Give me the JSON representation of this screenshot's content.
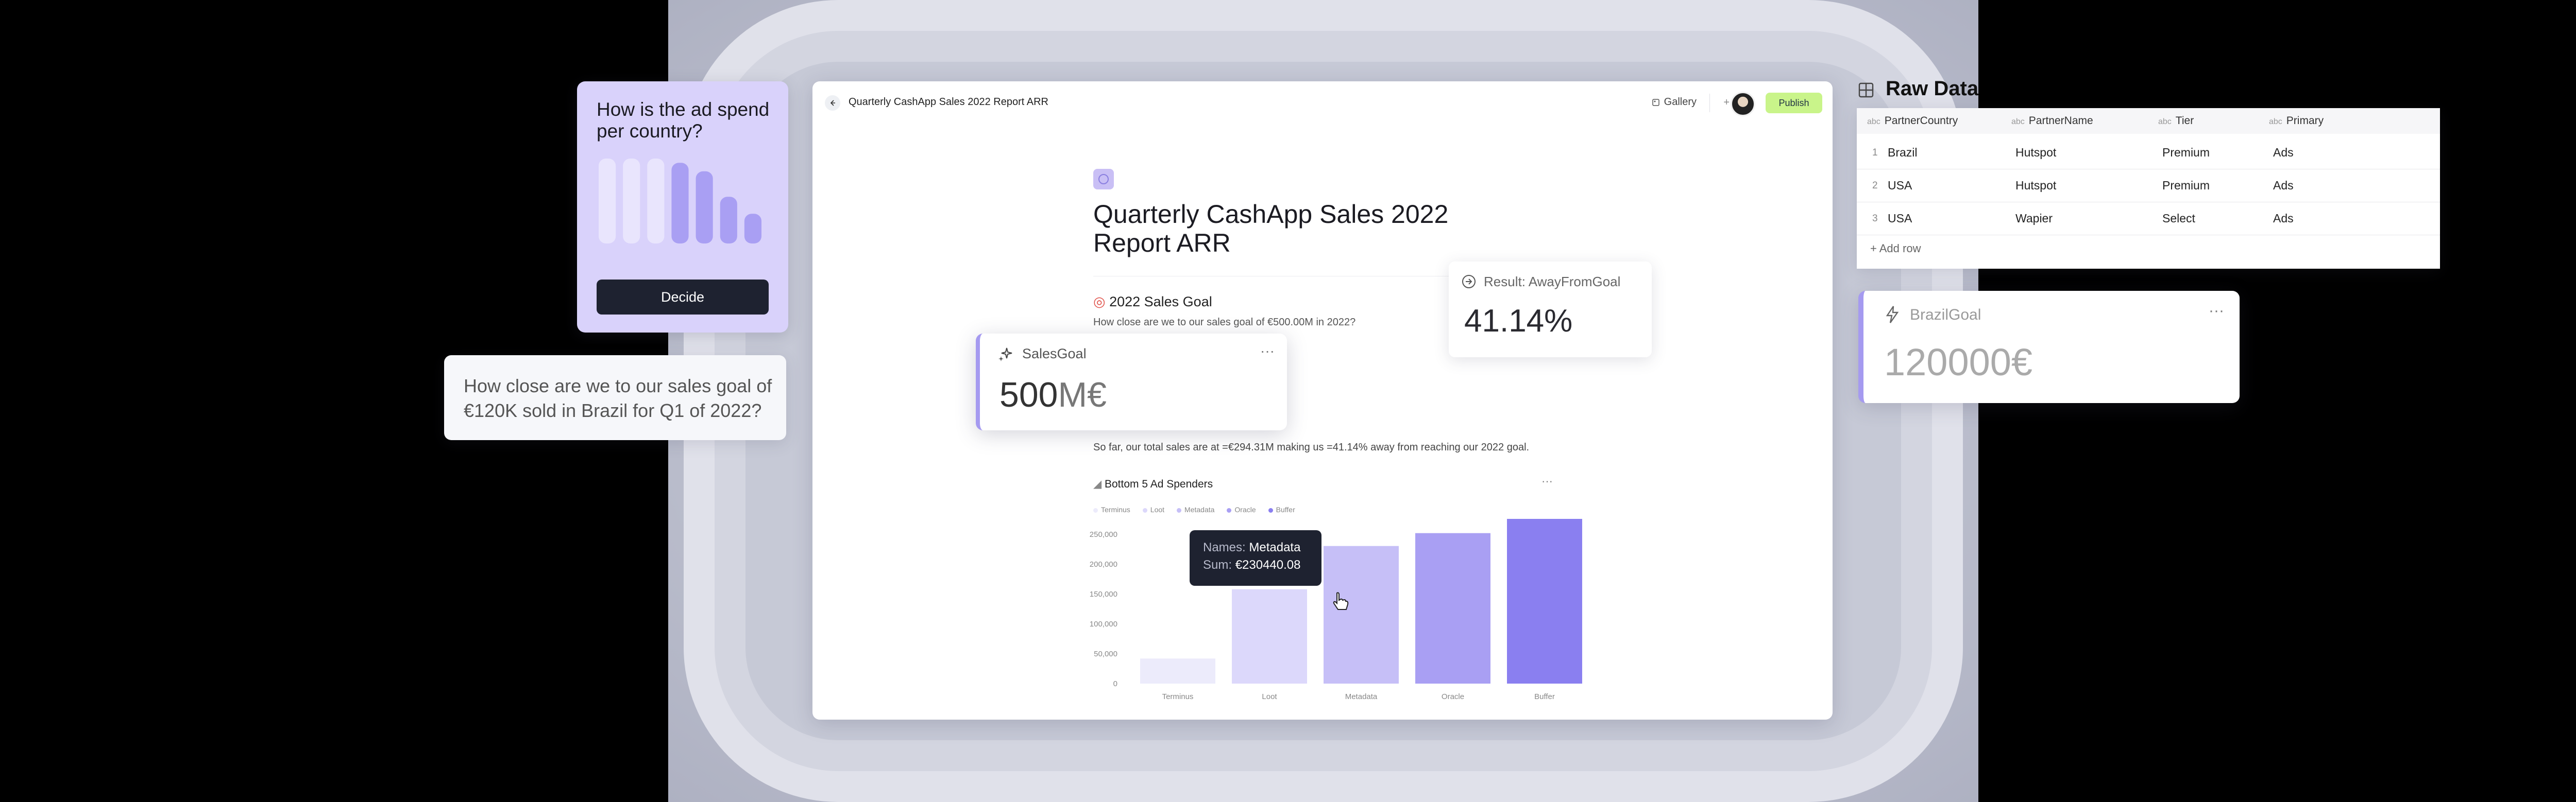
{
  "window": {
    "title": "Quarterly CashApp Sales 2022 Report ARR",
    "gallery_label": "Gallery",
    "publish_label": "Publish"
  },
  "document": {
    "title": "Quarterly CashApp Sales 2022 Report ARR",
    "section_title": "2022 Sales Goal",
    "section_sub": "How close are we to our sales goal of €500.00M in 2022?",
    "summary": "So far, our total sales are at =€294.31M making us =41.14% away from reaching our 2022 goal.",
    "chart_title": "Bottom 5 Ad Spenders"
  },
  "chart_data": {
    "type": "bar",
    "categories": [
      "Terminus",
      "Loot",
      "Metadata",
      "Oracle",
      "Buffer"
    ],
    "values": [
      42000,
      158000,
      230440.08,
      252000,
      290000
    ],
    "ylim": [
      0,
      250000
    ],
    "yticks": [
      "250,000",
      "200,000",
      "150,000",
      "100,000",
      "50,000",
      "0"
    ],
    "ytick_values": [
      250000,
      200000,
      150000,
      100000,
      50000,
      0
    ],
    "legend": [
      "Terminus",
      "Loot",
      "Metadata",
      "Oracle",
      "Buffer"
    ],
    "colors": [
      "#ecebfb",
      "#dcd8fb",
      "#c6bff7",
      "#a99ff3",
      "#8a7ff0"
    ]
  },
  "tooltip": {
    "names_key": "Names:",
    "names_val": "Metadata",
    "sum_key": "Sum:",
    "sum_val": "€230440.08"
  },
  "card_ad": {
    "question": "How is the ad spend per country?",
    "button": "Decide",
    "mini_bars": [
      1,
      1,
      1,
      0.95,
      0.85,
      0.55,
      0.35
    ]
  },
  "card_q2": {
    "text": "How close are we to our sales goal of €120K sold in Brazil for Q1 of 2022?"
  },
  "sales_goal": {
    "label": "SalesGoal",
    "value": "500",
    "unit": "M€"
  },
  "result": {
    "label": "Result: AwayFromGoal",
    "value": "41.14%"
  },
  "raw_data": {
    "title": "Raw Data",
    "abc": "abc",
    "columns": [
      "PartnerCountry",
      "PartnerName",
      "Tier",
      "Primary"
    ],
    "rows": [
      [
        "1",
        "Brazil",
        "Hutspot",
        "Premium",
        "Ads"
      ],
      [
        "2",
        "USA",
        "Hutspot",
        "Premium",
        "Ads"
      ],
      [
        "3",
        "USA",
        "Wapier",
        "Select",
        "Ads"
      ]
    ],
    "add_row": "Add row"
  },
  "brazil_goal": {
    "label": "BrazilGoal",
    "value": "120000€"
  }
}
